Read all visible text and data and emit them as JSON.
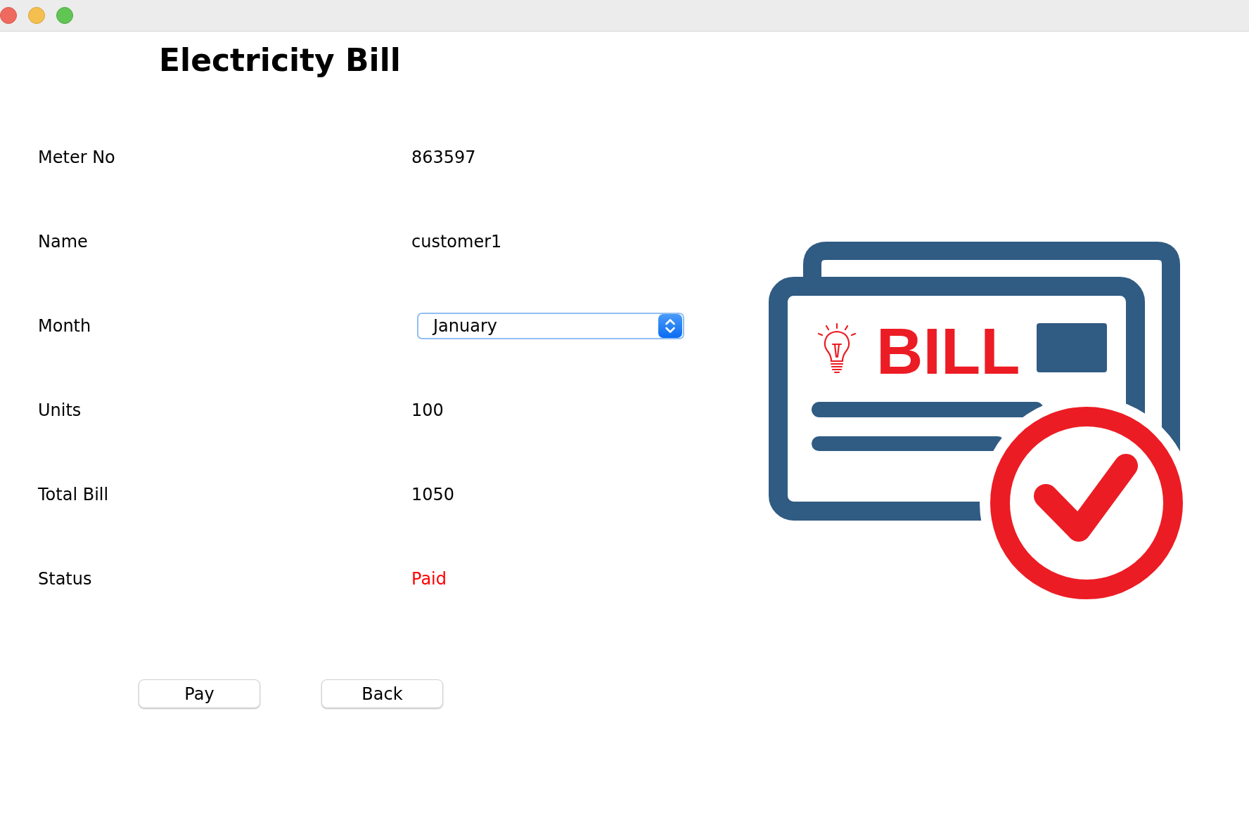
{
  "heading": "Electricity Bill",
  "fields": [
    {
      "label": "Meter No",
      "value": "863597",
      "kind": "text",
      "color": "#000000"
    },
    {
      "label": "Name",
      "value": "customer1",
      "kind": "text",
      "color": "#000000"
    },
    {
      "label": "Month",
      "value": "January",
      "kind": "dropdown",
      "color": "#000000"
    },
    {
      "label": "Units",
      "value": "100",
      "kind": "text",
      "color": "#000000"
    },
    {
      "label": "Total Bill",
      "value": "1050",
      "kind": "text",
      "color": "#000000"
    },
    {
      "label": "Status",
      "value": "Paid",
      "kind": "text",
      "color": "#ff0000"
    }
  ],
  "illustration": {
    "label": "BILL"
  },
  "buttons": [
    "Pay",
    "Back"
  ]
}
